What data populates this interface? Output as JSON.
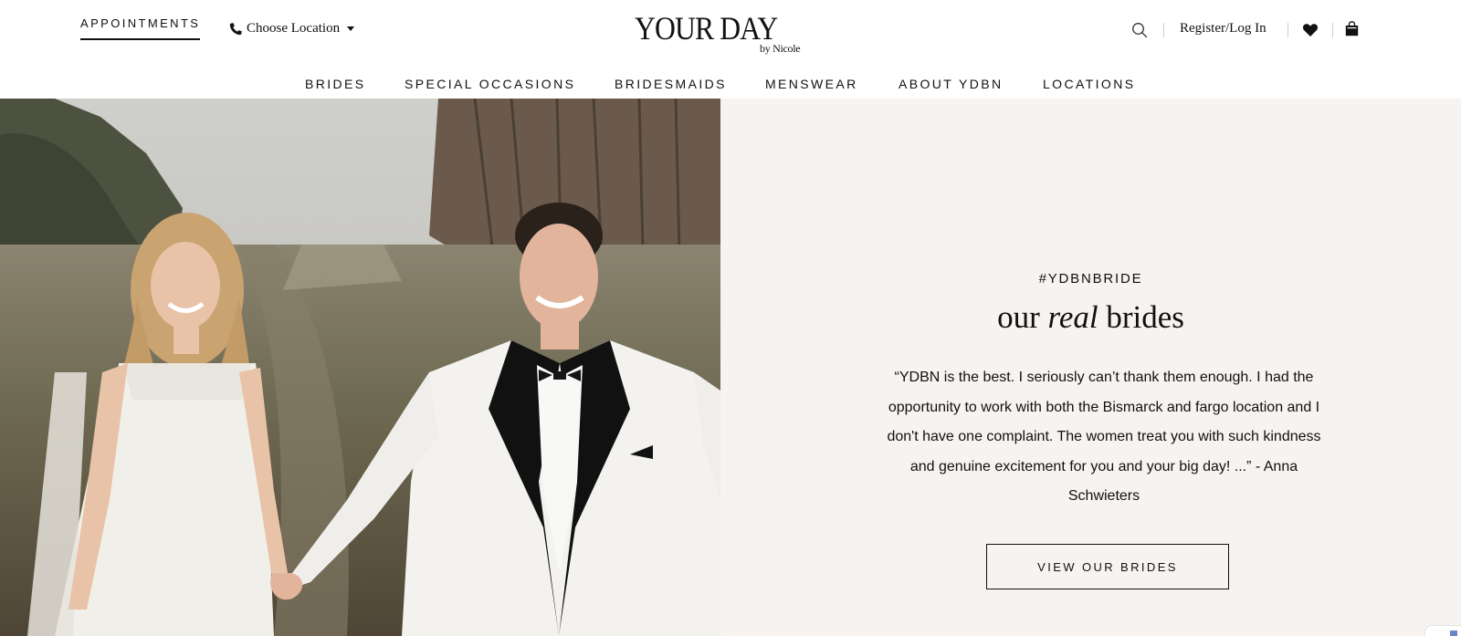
{
  "header": {
    "appointments_label": "APPOINTMENTS",
    "location_label": "Choose Location",
    "logo_main": "YOUR DAY",
    "logo_sub": "by Nicole",
    "register_label": "Register/Log In"
  },
  "nav": {
    "items": [
      {
        "label": "BRIDES"
      },
      {
        "label": "SPECIAL OCCASIONS"
      },
      {
        "label": "BRIDESMAIDS"
      },
      {
        "label": "MENSWEAR"
      },
      {
        "label": "ABOUT YDBN"
      },
      {
        "label": "LOCATIONS"
      }
    ]
  },
  "hero": {
    "hashtag": "#YDBNBRIDE",
    "headline_pre": "our ",
    "headline_em": "real",
    "headline_post": " brides",
    "quote": "“YDBN is the best. I seriously can’t thank them enough. I had the opportunity to work with both the Bismarck and fargo location and I don't have one complaint. The women treat you with such kindness and genuine excitement for you and your big day! ...” - Anna Schwieters",
    "cta_label": "VIEW OUR BRIDES"
  },
  "colors": {
    "panel_bg": "#f7f3f0",
    "text": "#111111",
    "accent": "#6a85c9"
  },
  "icons": [
    "phone-icon",
    "chevron-down-icon",
    "search-icon",
    "heart-icon",
    "shopping-bag-icon"
  ]
}
